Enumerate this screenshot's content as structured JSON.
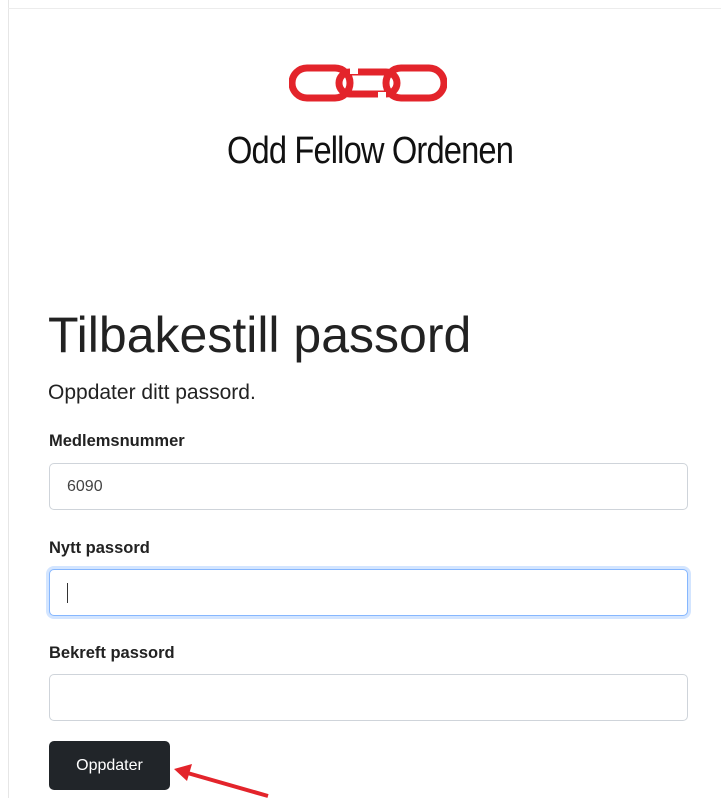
{
  "brand": {
    "logo_icon": "chain-link-logo-icon",
    "name": "Odd Fellow Ordenen",
    "accent_color": "#e3242b"
  },
  "form": {
    "title": "Tilbakestill passord",
    "subtitle": "Oppdater ditt passord.",
    "member_number": {
      "label": "Medlemsnummer",
      "value": "6090"
    },
    "new_password": {
      "label": "Nytt passord",
      "value": "",
      "focused": true
    },
    "confirm_password": {
      "label": "Bekreft passord",
      "value": ""
    },
    "submit_label": "Oppdater",
    "button_color": "#212529"
  },
  "annotation": {
    "arrow_icon": "red-arrow-icon",
    "arrow_color": "#e3242b"
  }
}
